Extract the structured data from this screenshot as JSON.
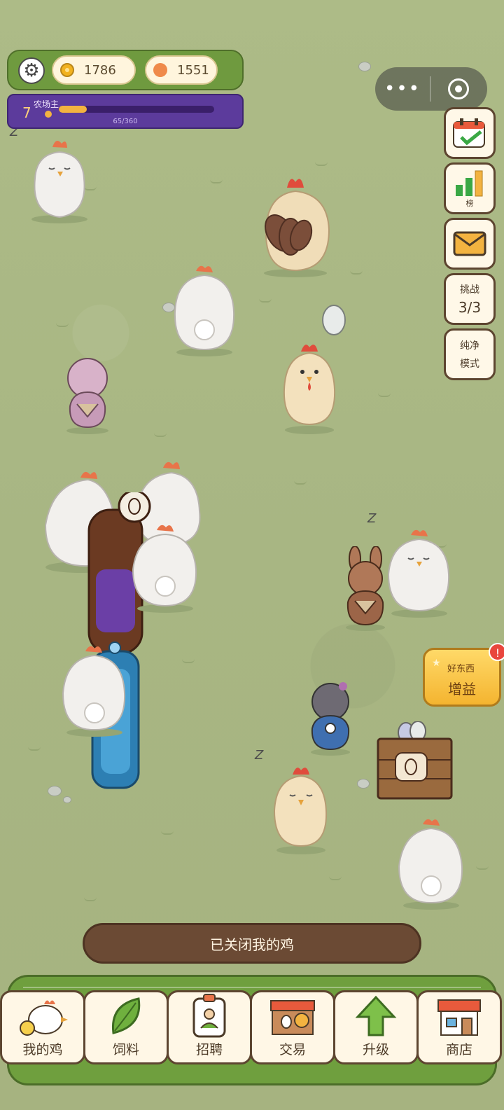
{
  "hud": {
    "coins": "1786",
    "gems": "1551",
    "level": "7",
    "level_title": "农场主",
    "xp_text": "65/360",
    "xp_fraction": 0.18
  },
  "side_buttons": {
    "rank_label": "榜",
    "challenge_label": "挑战",
    "challenge_count": "3/3",
    "pure_mode_line1": "纯净",
    "pure_mode_line2": "模式"
  },
  "goodies": {
    "line1": "好东西",
    "line2": "增益",
    "badge": "!"
  },
  "toast": {
    "message": "已关闭我的鸡"
  },
  "nav": {
    "my_chickens": "我的鸡",
    "feed": "饲料",
    "recruit": "招聘",
    "trade": "交易",
    "upgrade": "升级",
    "shop": "商店"
  },
  "sleep_text": "Z",
  "colors": {
    "grass": "#a9b884",
    "topbar": "#6f9a3f",
    "levelbar": "#5c3b9c",
    "accent_gold": "#f3b340"
  }
}
